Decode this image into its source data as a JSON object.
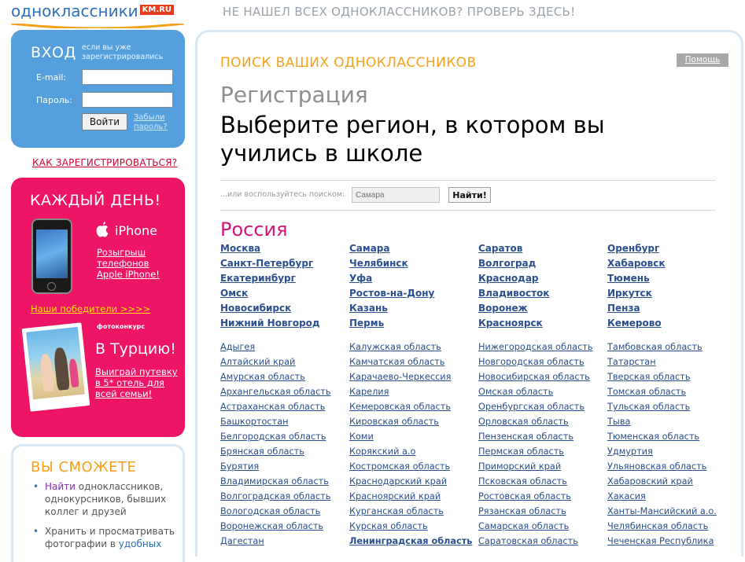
{
  "header": {
    "logo_text": "одноклассники",
    "logo_badge": "KM.RU",
    "banner": "НЕ НАШЕЛ ВСЕХ ОДНОКЛАССНИКОВ? ПРОВЕРЬ ЗДЕСЬ!"
  },
  "login": {
    "title": "ВХОД",
    "hint": "если вы уже зарегистрировались",
    "email_label": "E-mail:",
    "password_label": "Пароль:",
    "submit": "Войти",
    "forgot": "Забыли пароль?",
    "register": "КАК ЗАРЕГИСТРИРОВАТЬСЯ?"
  },
  "promo": {
    "title": "КАЖДЫЙ ДЕНЬ!",
    "iphone_label": "iPhone",
    "iphone_desc": "Розыгрыш телефонов Apple iPhone!",
    "winners": "Наши победители >>>>",
    "photo_contest": "фотоконкурс",
    "turkey_title": "В Турцию!",
    "turkey_desc": "Выиграй путевку в 5* отель для всей семьи!"
  },
  "can": {
    "title": "ВЫ СМОЖЕТЕ",
    "item1_hl": "Найти",
    "item1_rest": " одноклассников, однокурсников, бывших коллег и друзей",
    "item2_start": "Хранить и просматривать фотографии в ",
    "item2_hl": "удобных"
  },
  "main": {
    "help": "Помощь",
    "search_head": "ПОИСК ВАШИХ ОДНОКЛАССНИКОВ",
    "reg_title": "Регистрация",
    "region_title": "Выберите регион, в котором вы учились в школе",
    "search_hint": "...или воспользуйтесь поиском:",
    "search_placeholder": "Самара",
    "search_button": "Найти!",
    "country": "Россия"
  },
  "cities": [
    [
      "Москва",
      "Санкт-Петербург",
      "Екатеринбург",
      "Омск",
      "Новосибирск",
      "Нижний Новгород"
    ],
    [
      "Самара",
      "Челябинск",
      "Уфа",
      "Ростов-на-Дону",
      "Казань",
      "Пермь"
    ],
    [
      "Саратов",
      "Волгоград",
      "Краснодар",
      "Владивосток",
      "Воронеж",
      "Красноярск"
    ],
    [
      "Оренбург",
      "Хабаровск",
      "Тюмень",
      "Иркутск",
      "Пенза",
      "Кемерово"
    ]
  ],
  "regions": [
    [
      "Адыгея",
      "Алтайский край",
      "Амурская область",
      "Архангельская область",
      "Астраханская область",
      "Башкортостан",
      "Белгородская область",
      "Брянская область",
      "Бурятия",
      "Владимирская область",
      "Волгоградская область",
      "Вологодская область",
      "Воронежская область",
      "Дагестан"
    ],
    [
      "Калужская область",
      "Камчатская область",
      "Карачаево-Черкессия",
      "Карелия",
      "Кемеровская область",
      "Кировская область",
      "Коми",
      "Корякский а.о",
      "Костромская область",
      "Краснодарский край",
      "Красноярский край",
      "Курганская область",
      "Курская область",
      "Ленинградская область"
    ],
    [
      "Нижегородская область",
      "Новгородская область",
      "Новосибирская область",
      "Омская область",
      "Оренбургская область",
      "Орловская область",
      "Пензенская область",
      "Пермская область",
      "Приморский край",
      "Псковская область",
      "Ростовская область",
      "Рязанская область",
      "Самарская область",
      "Саратовская область"
    ],
    [
      "Тамбовская область",
      "Татарстан",
      "Тверская область",
      "Томская область",
      "Тульская область",
      "Тыва",
      "Тюменская область",
      "Удмуртия",
      "Ульяновская область",
      "Хабаровский край",
      "Хакасия",
      "Ханты-Мансийский а.о.",
      "Челябинская область",
      "Чеченская Республика"
    ]
  ],
  "colors": {
    "login_bg": "#55a0dc",
    "promo_bg": "#ee1466",
    "accent_orange": "#f7a11a",
    "link_blue": "#2b4f8f",
    "country_pink": "#d6137a"
  }
}
